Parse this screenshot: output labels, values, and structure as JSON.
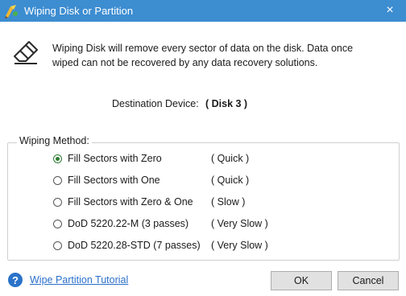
{
  "window": {
    "title": "Wiping Disk or Partition",
    "close_glyph": "×",
    "icon": "partition-wizard-icon",
    "accent": "#3d8dd1"
  },
  "warning": {
    "line1": "Wiping Disk will remove every sector of data on the disk. Data once",
    "line2": "wiped can not be recovered by any data recovery solutions.",
    "icon": "eraser-icon"
  },
  "destination": {
    "label": "Destination Device:",
    "value": "( Disk 3 )"
  },
  "wiping_method": {
    "legend": "Wiping Method:",
    "selected_index": 0,
    "options": [
      {
        "label": "Fill Sectors with Zero",
        "speed": "( Quick )",
        "checked": true
      },
      {
        "label": "Fill Sectors with One",
        "speed": "( Quick )",
        "checked": false
      },
      {
        "label": "Fill Sectors with Zero & One",
        "speed": "( Slow )",
        "checked": false
      },
      {
        "label": "DoD 5220.22-M (3 passes)",
        "speed": "( Very Slow )",
        "checked": false
      },
      {
        "label": "DoD 5220.28-STD (7 passes)",
        "speed": "( Very Slow )",
        "checked": false
      }
    ]
  },
  "footer": {
    "help_icon_glyph": "?",
    "help_link": "Wipe Partition Tutorial",
    "ok_label": "OK",
    "cancel_label": "Cancel"
  }
}
